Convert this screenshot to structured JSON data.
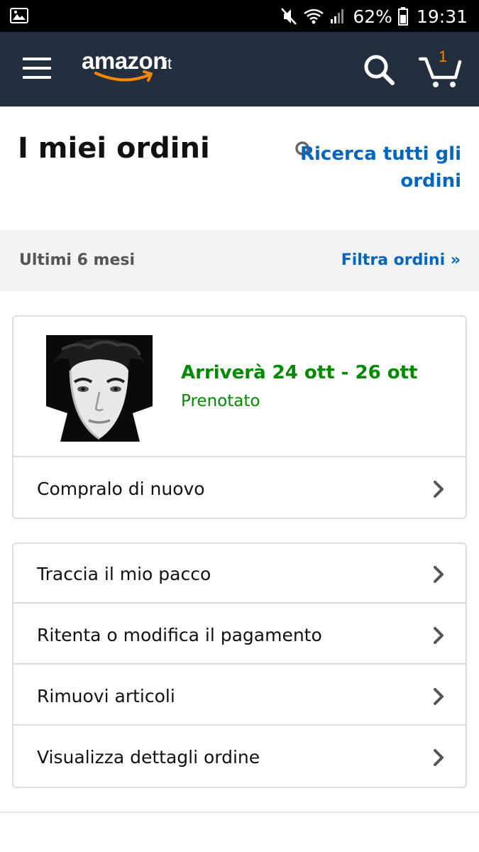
{
  "status_bar": {
    "battery": "62%",
    "time": "19:31",
    "icons": [
      "gallery-icon",
      "mute-icon",
      "wifi-icon",
      "signal-icon",
      "battery-icon"
    ]
  },
  "header": {
    "logo_text": "amazon",
    "logo_tld": ".it",
    "cart_count": "1",
    "icons": [
      "menu-icon",
      "search-icon",
      "cart-icon"
    ],
    "colors": {
      "background": "#232f3e",
      "accent": "#f08804"
    }
  },
  "page": {
    "title": "I miei ordini",
    "search_all_line1": "Ricerca tutti gli",
    "search_all_line2": "ordini"
  },
  "filter": {
    "period": "Ultimi 6 mesi",
    "link": "Filtra ordini »"
  },
  "order": {
    "eta": "Arriverà 24 ott - 26 ott",
    "status": "Prenotato",
    "buy_again": "Compralo di nuovo",
    "status_color": "#008a00"
  },
  "actions": [
    {
      "label": "Traccia il mio pacco"
    },
    {
      "label": "Ritenta o modifica il pagamento"
    },
    {
      "label": "Rimuovi articoli"
    },
    {
      "label": "Visualizza dettagli ordine"
    }
  ],
  "colors": {
    "link": "#0066c0"
  }
}
